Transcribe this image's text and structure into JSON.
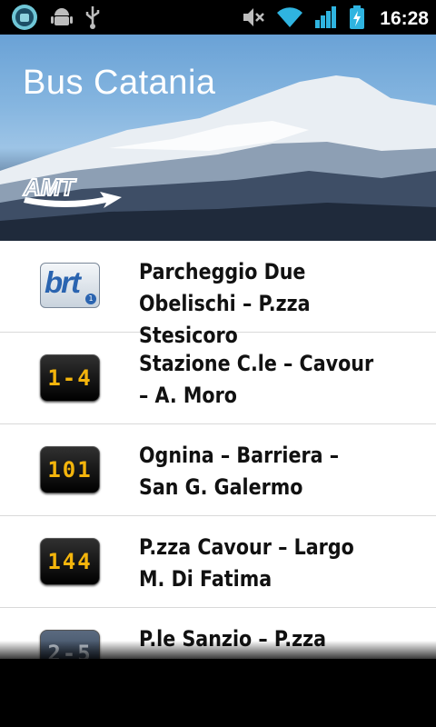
{
  "status_bar": {
    "time": "16:28",
    "left_icons": [
      "app-notification-icon",
      "android-debug-icon",
      "usb-icon"
    ],
    "right_icons": [
      "mute-icon",
      "wifi-icon",
      "signal-icon",
      "battery-charging-icon"
    ]
  },
  "header": {
    "title": "Bus Catania",
    "logo_text": "AMT"
  },
  "routes": [
    {
      "badge": "brt",
      "badge_sub": "1",
      "label": "Parcheggio Due Obelischi – P.zza Stesicoro"
    },
    {
      "badge": "1-4",
      "label": "Stazione C.le – Cavour – A. Moro"
    },
    {
      "badge": "101",
      "label": "Ognina – Barriera – San G. Galermo"
    },
    {
      "badge": "144",
      "label": "P.zza Cavour – Largo M. Di Fatima"
    },
    {
      "badge": "2-5",
      "label": "P.le Sanzio – P.zza"
    }
  ],
  "colors": {
    "led_text": "#f4b50c",
    "brt_blue": "#2a64b0",
    "sky": "#86b6e0"
  }
}
